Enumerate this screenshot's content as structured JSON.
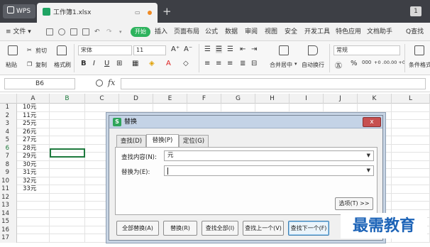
{
  "titlebar": {
    "app_tab": "WPS",
    "doc_tab": "工作簿1.xlsx",
    "add_tab": "+",
    "window_badge": "1"
  },
  "menubar": {
    "file_menu": "≡ 文件 ▾",
    "start_label": "开始",
    "items": [
      "插入",
      "页面布局",
      "公式",
      "数据",
      "审阅",
      "视图",
      "安全",
      "开发工具",
      "特色应用",
      "文档助手"
    ],
    "search_label": "Q查找"
  },
  "ribbon": {
    "paste": "粘贴",
    "cut": "剪切",
    "copy": "复制",
    "format_painter": "格式刷",
    "font_name": "宋体",
    "font_size": "11",
    "grow_font": "A⁺",
    "shrink_font": "A⁻",
    "bold": "B",
    "italic": "I",
    "underline": "U",
    "merge_center": "合并居中",
    "wrap_text": "自动换行",
    "number_format": "常规",
    "percent": "%",
    "thousands": "000",
    "inc_decimal": "+0 .00",
    "dec_decimal": ".00 +0",
    "conditional_format": "条件格式"
  },
  "formula_bar": {
    "name_box": "B6",
    "fx": "fx",
    "value": ""
  },
  "grid": {
    "columns": [
      "A",
      "B",
      "C",
      "D",
      "E",
      "F",
      "G",
      "H",
      "I",
      "J",
      "K",
      "L"
    ],
    "rows": [
      "1",
      "2",
      "3",
      "4",
      "5",
      "6",
      "7",
      "8",
      "9",
      "10",
      "11",
      "12",
      "13",
      "14",
      "15",
      "16",
      "17"
    ],
    "column_a_values": [
      "10元",
      "11元",
      "25元",
      "26元",
      "27元",
      "28元",
      "29元",
      "30元",
      "31元",
      "32元",
      "33元"
    ],
    "selected_cell": "B6"
  },
  "dialog": {
    "title": "替换",
    "close": "x",
    "tabs": [
      "查找(D)",
      "替换(P)",
      "定位(G)"
    ],
    "active_tab": "替换(P)",
    "find_label": "查找内容(N):",
    "find_value": "元",
    "replace_label": "替换为(E):",
    "replace_value": "",
    "options_button": "选项(T) >>",
    "buttons": [
      "全部替换(A)",
      "替换(R)",
      "查找全部(I)",
      "查找上一个(V)",
      "查找下一个(F)"
    ]
  },
  "watermark": "最需教育",
  "colors": {
    "titlebar": "#3d3f45",
    "accent_green": "#2db35d",
    "selection_border": "#1e7a3e",
    "dialog_close": "#c75050",
    "watermark": "#1c63b7"
  }
}
